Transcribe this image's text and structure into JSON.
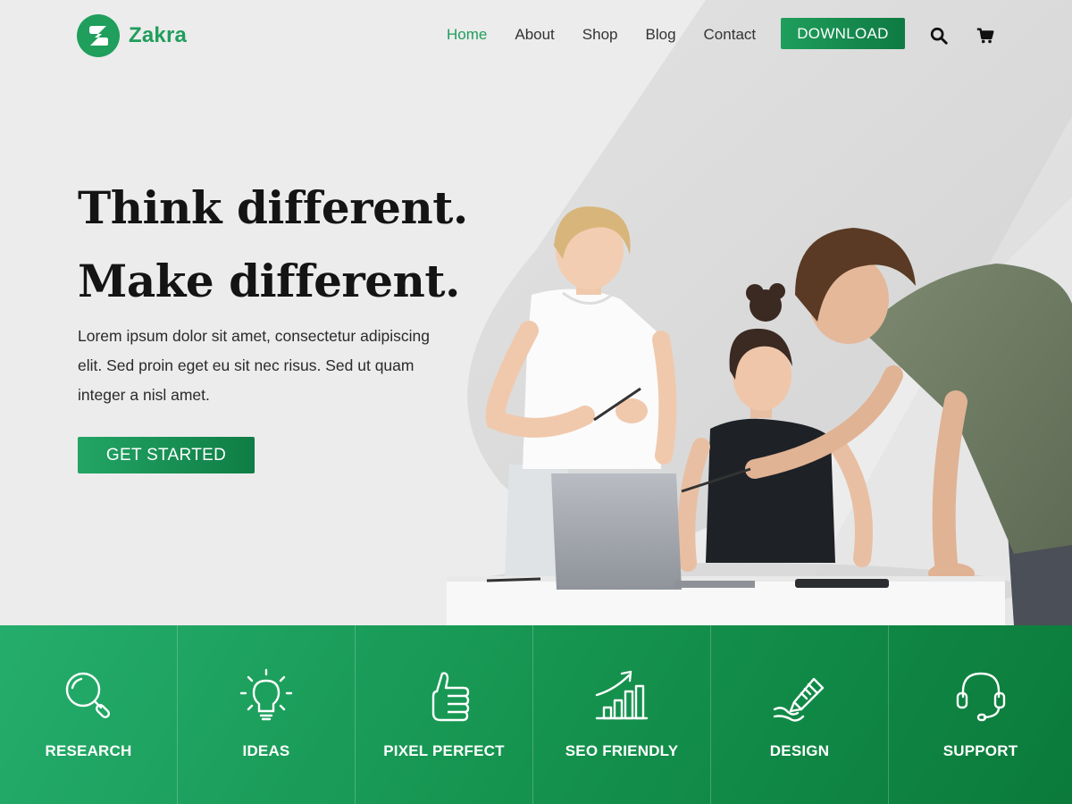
{
  "brand": {
    "name": "Zakra",
    "color": "#1f9e5c"
  },
  "nav": {
    "items": [
      {
        "label": "Home",
        "active": true
      },
      {
        "label": "About",
        "active": false
      },
      {
        "label": "Shop",
        "active": false
      },
      {
        "label": "Blog",
        "active": false
      },
      {
        "label": "Contact",
        "active": false
      }
    ],
    "download_label": "DOWNLOAD",
    "search_icon": "search-icon",
    "cart_icon": "cart-icon"
  },
  "hero": {
    "headline_1": "Think different.",
    "headline_2": "Make different.",
    "lead": "Lorem ipsum dolor sit amet, consectetur adipiscing elit. Sed proin eget eu sit nec risus. Sed ut quam integer a nisl amet.",
    "cta_label": "GET STARTED"
  },
  "features": [
    {
      "label": "RESEARCH",
      "icon": "magnifier-icon"
    },
    {
      "label": "IDEAS",
      "icon": "lightbulb-icon"
    },
    {
      "label": "PIXEL PERFECT",
      "icon": "thumbs-up-icon"
    },
    {
      "label": "SEO FRIENDLY",
      "icon": "growth-chart-icon"
    },
    {
      "label": "DESIGN",
      "icon": "pencil-icon"
    },
    {
      "label": "SUPPORT",
      "icon": "headset-icon"
    }
  ],
  "colors": {
    "accent": "#1f9e5c",
    "accent_dark": "#0b7a3a",
    "hero_bg": "#ececec"
  }
}
